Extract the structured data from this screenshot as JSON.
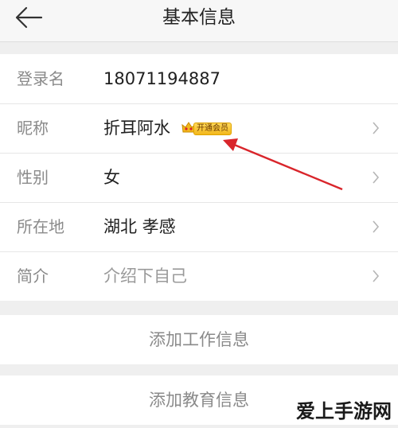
{
  "header": {
    "title": "基本信息",
    "back_icon": "back-arrow-icon"
  },
  "profile": {
    "rows": [
      {
        "label": "登录名",
        "value": "18071194887",
        "has_chevron": false
      },
      {
        "label": "昵称",
        "value": "折耳阿水",
        "has_chevron": true
      },
      {
        "label": "性别",
        "value": "女",
        "has_chevron": true
      },
      {
        "label": "所在地",
        "value": "湖北 孝感",
        "has_chevron": true
      },
      {
        "label": "简介",
        "value": "介绍下自己",
        "has_chevron": true
      }
    ],
    "vip_badge": "开通会员"
  },
  "actions": {
    "add_work": "添加工作信息",
    "add_education": "添加教育信息"
  },
  "watermark": "爱上手游网",
  "colors": {
    "annotation_arrow": "#d9252b",
    "vip_badge": "#f5c22e"
  }
}
